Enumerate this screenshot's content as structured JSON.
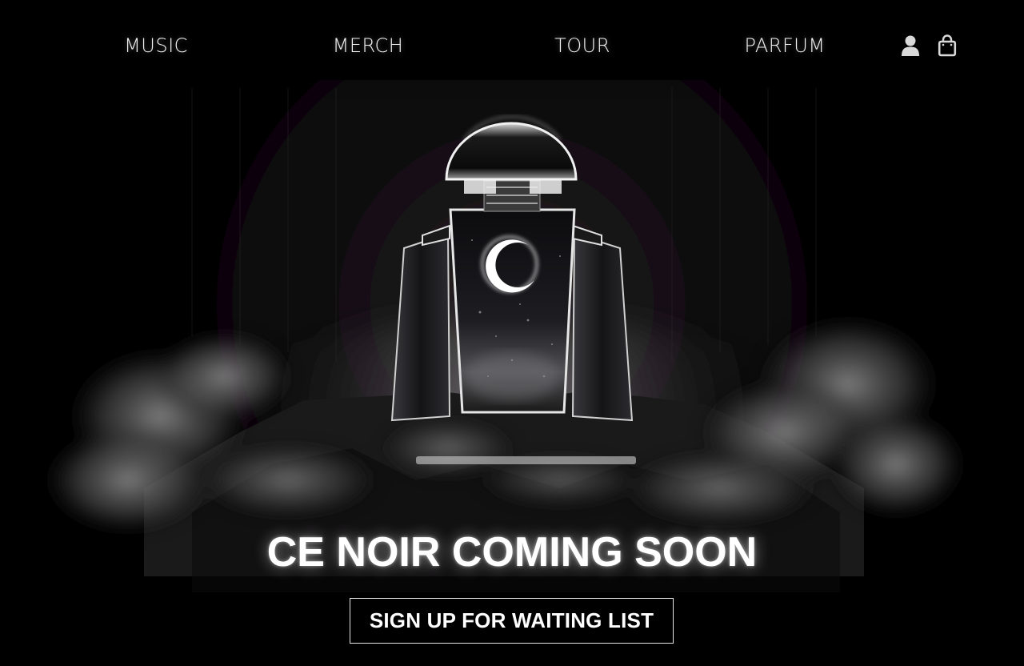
{
  "nav": {
    "items": [
      {
        "label": "MUSIC"
      },
      {
        "label": "MERCH"
      },
      {
        "label": "TOUR"
      },
      {
        "label": "PARFUM"
      }
    ],
    "account_icon": "user-icon",
    "cart_icon": "shopping-bag-icon"
  },
  "hero": {
    "image": "perfume-bottle-with-crescent-moon-among-clouds",
    "headline": "CE NOIR COMING SOON",
    "cta_label": "SIGN UP FOR WAITING LIST"
  },
  "colors": {
    "background": "#000000",
    "text": "#ffffff",
    "icon": "#d9d9d9"
  }
}
